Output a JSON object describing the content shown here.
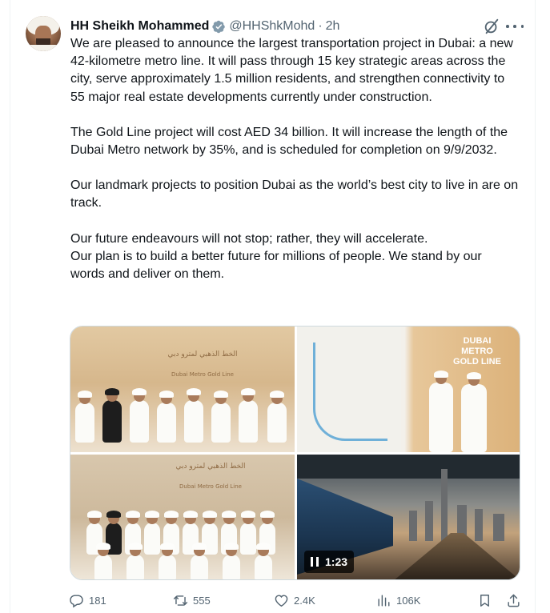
{
  "author": {
    "name": "HH Sheikh Mohammed",
    "handle": "@HHShkMohd",
    "separator": "·",
    "time": "2h"
  },
  "tweet": {
    "paragraphs": [
      "We are pleased to announce the largest transportation project in Dubai: a new 42-kilometre metro line. It will pass through 15 key strategic areas across the city, serve approximately 1.5 million residents, and strengthen connectivity to 55 major real estate developments currently under construction.",
      "The Gold Line project will cost AED 34 billion. It will increase the length of the Dubai Metro network by 35%, and is scheduled for completion on 9/9/2032.",
      "Our landmark projects to position Dubai as the world’s best city to live in are on track.",
      "Our future endeavours will not stop; rather, they will accelerate.",
      "Our plan is to build a better future for millions of people. We stand by our words and deliver on them."
    ]
  },
  "media": {
    "image1_sign": "الخط الذهبي لمترو دبي",
    "image1_sign_sub": "Dubai Metro Gold Line",
    "image2_sign": "DUBAI METRO GOLD LINE",
    "image3_sign": "الخط الذهبي لمترو دبي",
    "image3_sign_sub": "Dubai Metro Gold Line",
    "video_duration": "1:23"
  },
  "actions": {
    "replies": "181",
    "reposts": "555",
    "likes": "2.4K",
    "views": "106K"
  },
  "colors": {
    "verified": "#829aab",
    "secondary_text": "#536471",
    "primary_text": "#0f1419"
  }
}
